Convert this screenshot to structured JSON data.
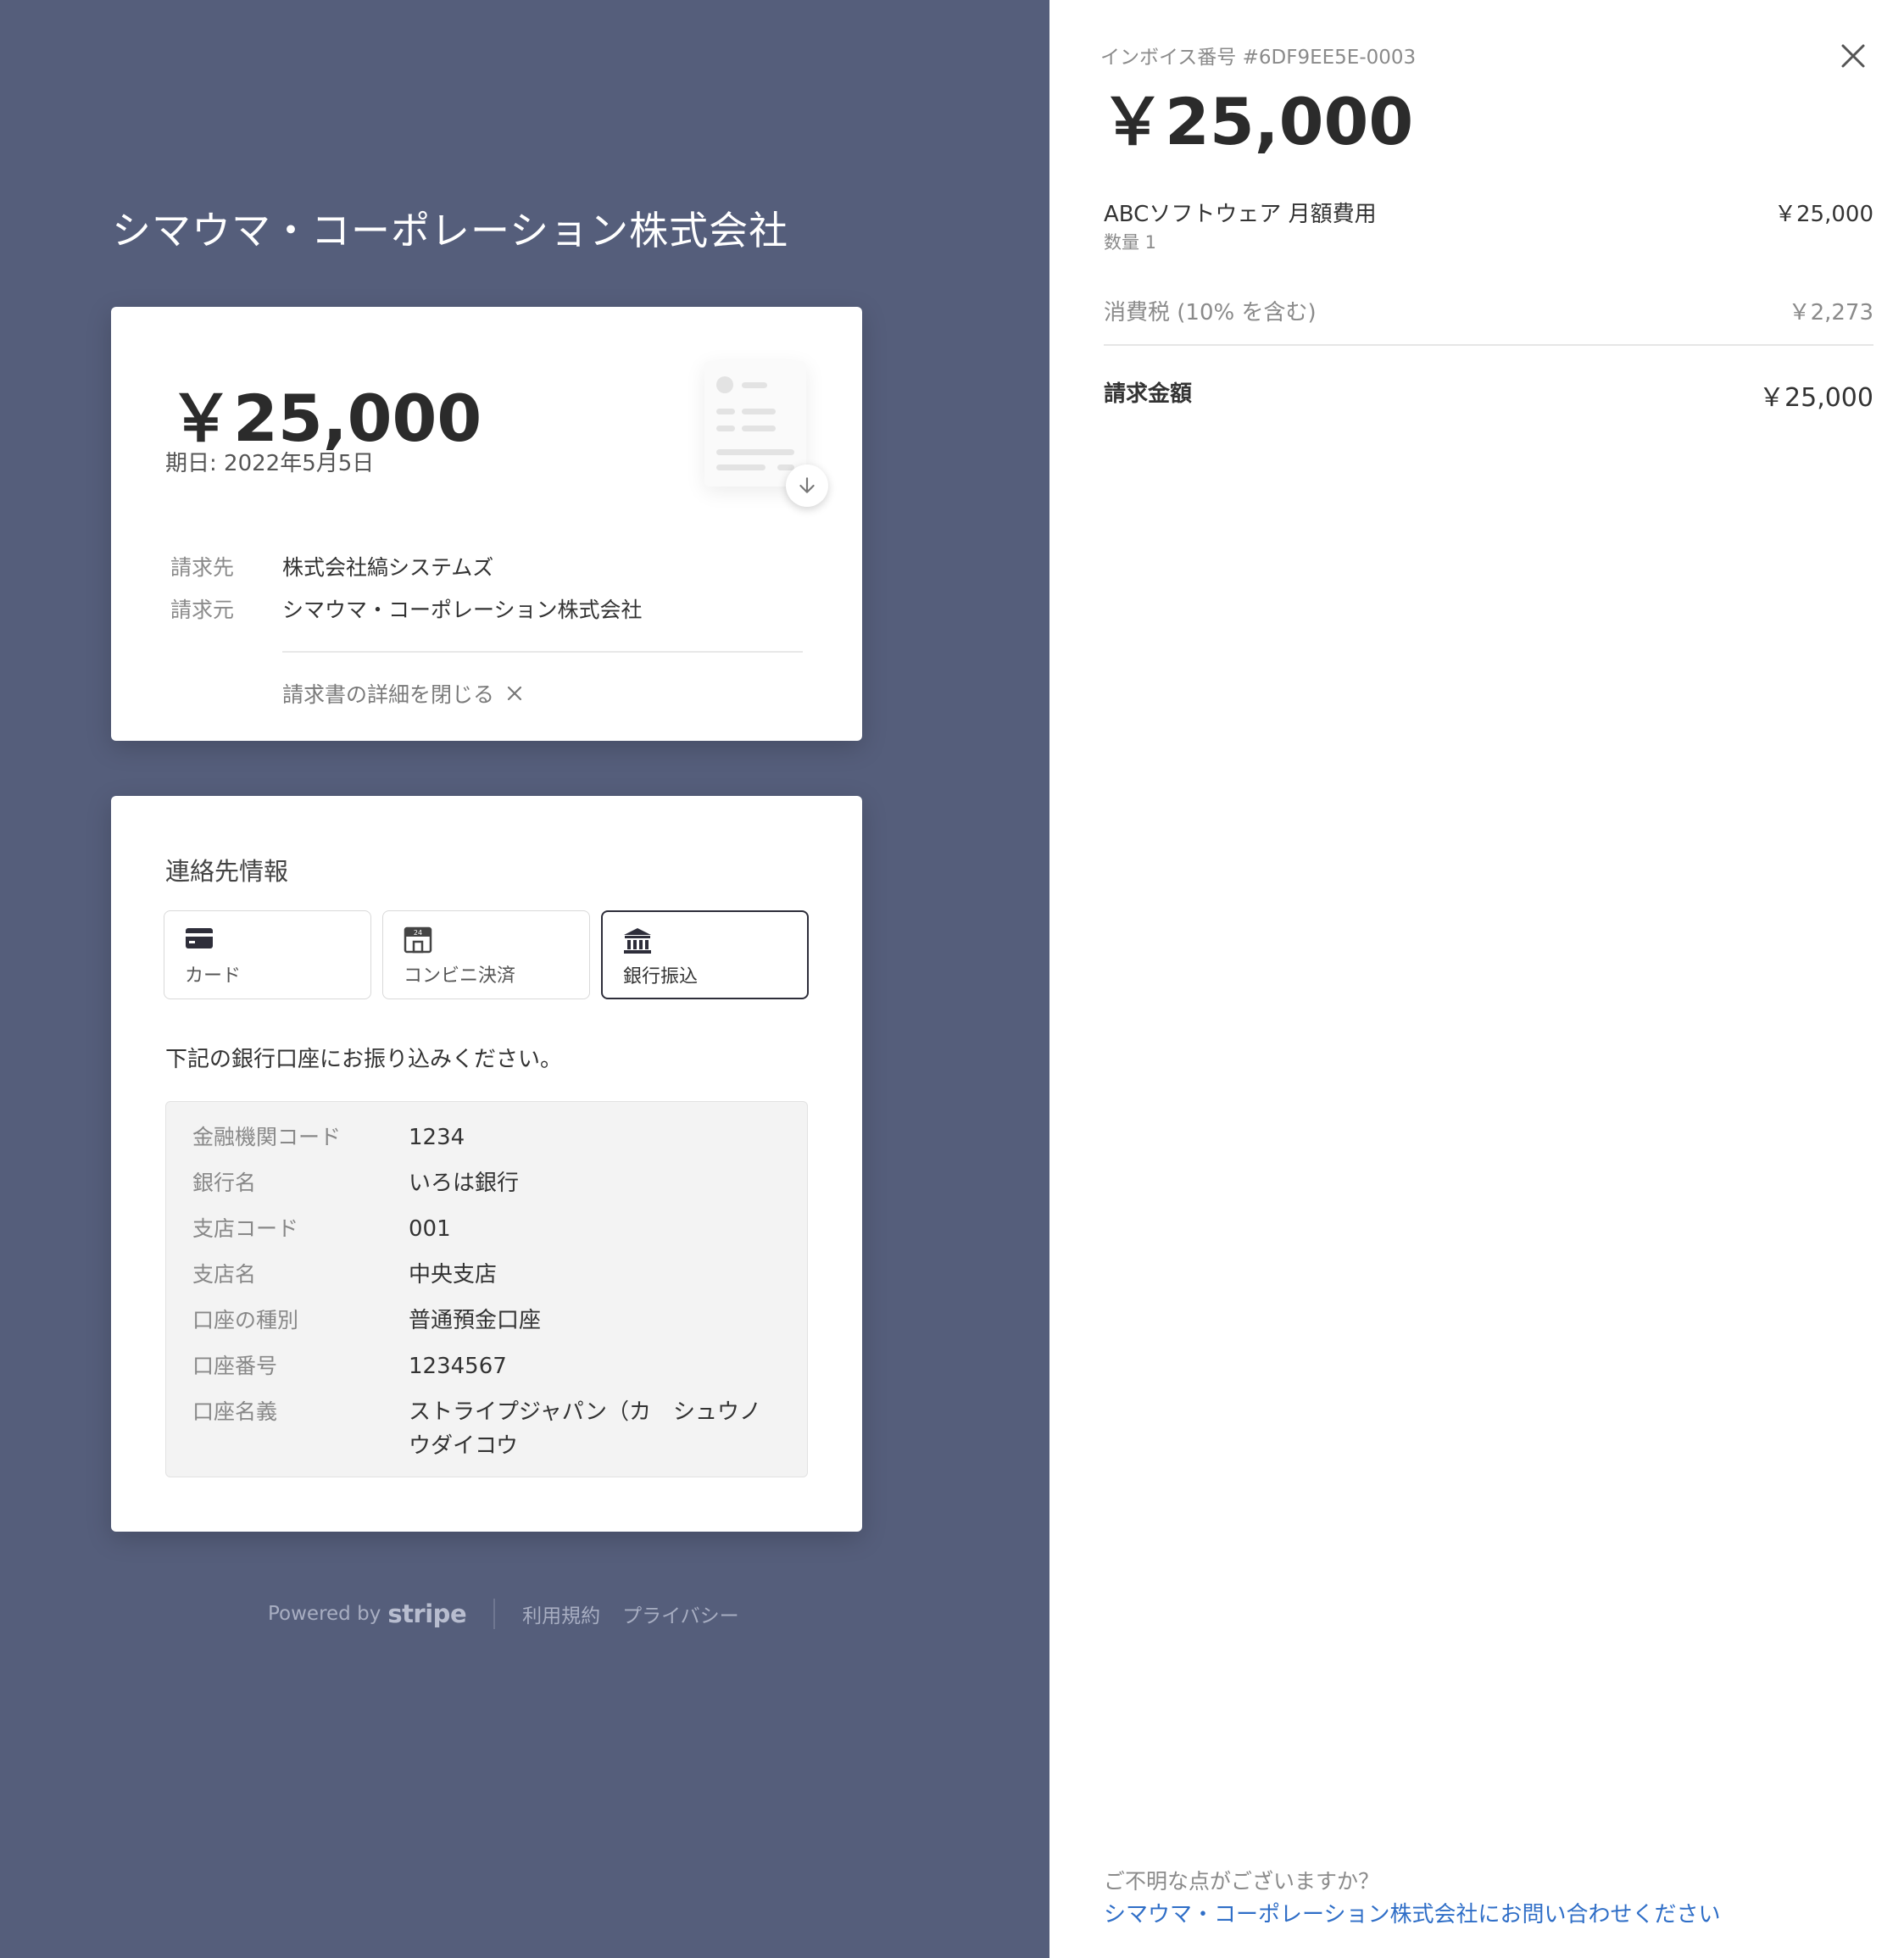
{
  "merchant": {
    "name": "シマウマ・コーポレーション株式会社"
  },
  "summary_card": {
    "amount": "￥25,000",
    "due_date": "期日: 2022年5月5日",
    "bill_to_label": "請求先",
    "bill_to_value": "株式会社縞システムズ",
    "bill_from_label": "請求元",
    "bill_from_value": "シマウマ・コーポレーション株式会社",
    "close_details_label": "請求書の詳細を閉じる"
  },
  "payment_card": {
    "title": "連絡先情報",
    "methods": [
      {
        "label": "カード",
        "icon": "credit-card-icon",
        "active": false
      },
      {
        "label": "コンビニ決済",
        "icon": "convenience-store-icon",
        "active": false
      },
      {
        "label": "銀行振込",
        "icon": "bank-icon",
        "active": true
      }
    ],
    "instructions": "下記の銀行口座にお振り込みください。",
    "bank_details": [
      {
        "label": "金融機関コード",
        "value": "1234"
      },
      {
        "label": "銀行名",
        "value": "いろは銀行"
      },
      {
        "label": "支店コード",
        "value": "001"
      },
      {
        "label": "支店名",
        "value": "中央支店"
      },
      {
        "label": "口座の種別",
        "value": "普通預金口座"
      },
      {
        "label": "口座番号",
        "value": "1234567"
      },
      {
        "label": "口座名義",
        "value": "ストライプジャパン（カ　シュウノウダイコウ"
      }
    ]
  },
  "footer": {
    "powered_by": "Powered by",
    "stripe": "stripe",
    "terms": "利用規約",
    "privacy": "プライバシー"
  },
  "detail_panel": {
    "invoice_number": "インボイス番号 #6DF9EE5E-0003",
    "amount": "￥25,000",
    "line_item": {
      "name": "ABCソフトウェア 月額費用",
      "quantity": "数量 1",
      "amount": "￥25,000"
    },
    "tax": {
      "label": "消費税 (10% を含む)",
      "amount": "￥2,273"
    },
    "total": {
      "label": "請求金額",
      "amount": "￥25,000"
    },
    "question": "ご不明な点がございますか？",
    "contact_link": "シマウマ・コーポレーション株式会社にお問い合わせください"
  },
  "colors": {
    "background": "#555e7b",
    "panel": "#ffffff",
    "link": "#2f6ec7",
    "active_border": "#2e2e3a"
  }
}
